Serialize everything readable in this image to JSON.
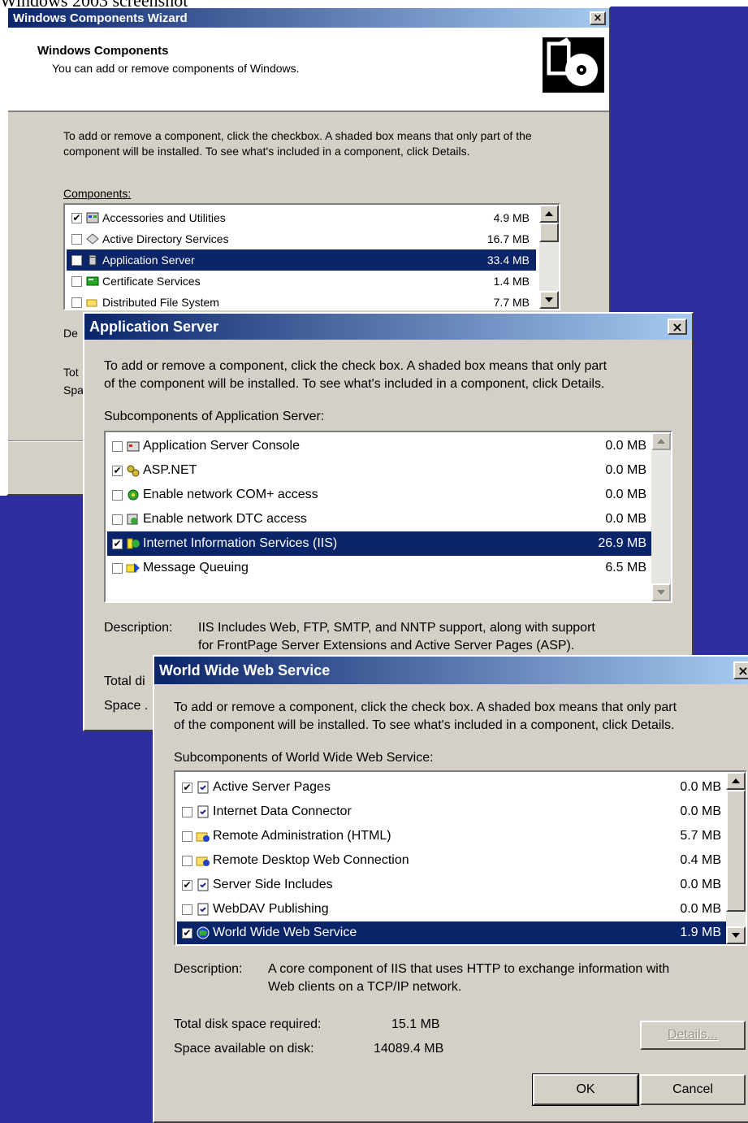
{
  "caption": "Windows 2003 screenshot",
  "colors": {
    "desktop": "#2e2e9e",
    "title_start": "#0a246a",
    "title_end": "#a6caf0",
    "dialog_face": "#d4d0c8",
    "selection": "#0a246a"
  },
  "wizard": {
    "title": "Windows Components Wizard",
    "close_glyph": "×",
    "header_title": "Windows Components",
    "header_subtitle": "You can add or remove components of Windows.",
    "instructions": "To add or remove a component, click the checkbox.  A shaded box means that only part of the component will be installed.  To see what's included in a component, click Details.",
    "components_label": "Components:",
    "components": [
      {
        "label": "Accessories and Utilities",
        "size": "4.9 MB",
        "checked": true,
        "selected": false,
        "icon": "accessories-icon"
      },
      {
        "label": "Active Directory Services",
        "size": "16.7 MB",
        "checked": false,
        "selected": false,
        "icon": "directory-icon"
      },
      {
        "label": "Application Server",
        "size": "33.4 MB",
        "checked": false,
        "selected": true,
        "icon": "server-icon"
      },
      {
        "label": "Certificate Services",
        "size": "1.4 MB",
        "checked": false,
        "selected": false,
        "icon": "certificate-icon"
      },
      {
        "label": "Distributed File System",
        "size": "7.7 MB",
        "checked": false,
        "selected": false,
        "icon": "folder-network-icon"
      }
    ],
    "desc_stub": "De",
    "total_stub": "Tot",
    "space_stub": "Spa"
  },
  "appserver": {
    "title": "Application Server",
    "close_glyph": "×",
    "instructions_line1": "To add or remove a component, click the check box. A shaded box means that only part",
    "instructions_line2": "of the component will be installed. To see what's included in a component, click Details.",
    "subcomponents_label": "Subcomponents of Application Server:",
    "subcomponents": [
      {
        "label": "Application Server Console",
        "size": "0.0 MB",
        "checked": false,
        "selected": false,
        "icon": "console-icon"
      },
      {
        "label": "ASP.NET",
        "size": "0.0 MB",
        "checked": true,
        "selected": false,
        "icon": "gears-icon"
      },
      {
        "label": "Enable network COM+ access",
        "size": "0.0 MB",
        "checked": false,
        "selected": false,
        "icon": "com-icon"
      },
      {
        "label": "Enable network DTC access",
        "size": "0.0 MB",
        "checked": false,
        "selected": false,
        "icon": "dtc-icon"
      },
      {
        "label": "Internet Information Services (IIS)",
        "size": "26.9 MB",
        "checked": true,
        "selected": true,
        "icon": "iis-icon"
      },
      {
        "label": "Message Queuing",
        "size": "6.5 MB",
        "checked": false,
        "selected": false,
        "icon": "message-queue-icon"
      }
    ],
    "description_label": "Description:",
    "description_line1": "IIS Includes Web, FTP, SMTP, and NNTP support, along with support",
    "description_line2": "for FrontPage Server Extensions and Active Server Pages (ASP).",
    "total_stub": "Total di",
    "space_stub": "Space ."
  },
  "www": {
    "title": "World Wide Web Service",
    "close_glyph": "×",
    "instructions_line1": "To add or remove a component, click the check box. A shaded box means that only part",
    "instructions_line2": "of the component will be installed. To see what's included in a component, click Details.",
    "subcomponents_label": "Subcomponents of World Wide Web Service:",
    "subcomponents": [
      {
        "label": "Active Server Pages",
        "size": "0.0 MB",
        "checked": true,
        "selected": false,
        "icon": "page-icon"
      },
      {
        "label": "Internet Data Connector",
        "size": "0.0 MB",
        "checked": false,
        "selected": false,
        "icon": "page-icon"
      },
      {
        "label": "Remote Administration (HTML)",
        "size": "5.7 MB",
        "checked": false,
        "selected": false,
        "icon": "folder-globe-icon"
      },
      {
        "label": "Remote Desktop Web Connection",
        "size": "0.4 MB",
        "checked": false,
        "selected": false,
        "icon": "folder-globe-icon"
      },
      {
        "label": "Server Side Includes",
        "size": "0.0 MB",
        "checked": true,
        "selected": false,
        "icon": "page-icon"
      },
      {
        "label": "WebDAV Publishing",
        "size": "0.0 MB",
        "checked": false,
        "selected": false,
        "icon": "page-icon"
      },
      {
        "label": "World Wide Web Service",
        "size": "1.9 MB",
        "checked": true,
        "selected": true,
        "icon": "globe-icon"
      }
    ],
    "description_label": "Description:",
    "description_line1": "A core component of IIS that uses HTTP to exchange information with",
    "description_line2": "Web clients on a TCP/IP network.",
    "total_label": "Total disk space required:",
    "total_value": "15.1 MB",
    "space_label": "Space available on disk:",
    "space_value": "14089.4 MB",
    "details_button": "Details...",
    "ok_button": "OK",
    "cancel_button": "Cancel"
  }
}
